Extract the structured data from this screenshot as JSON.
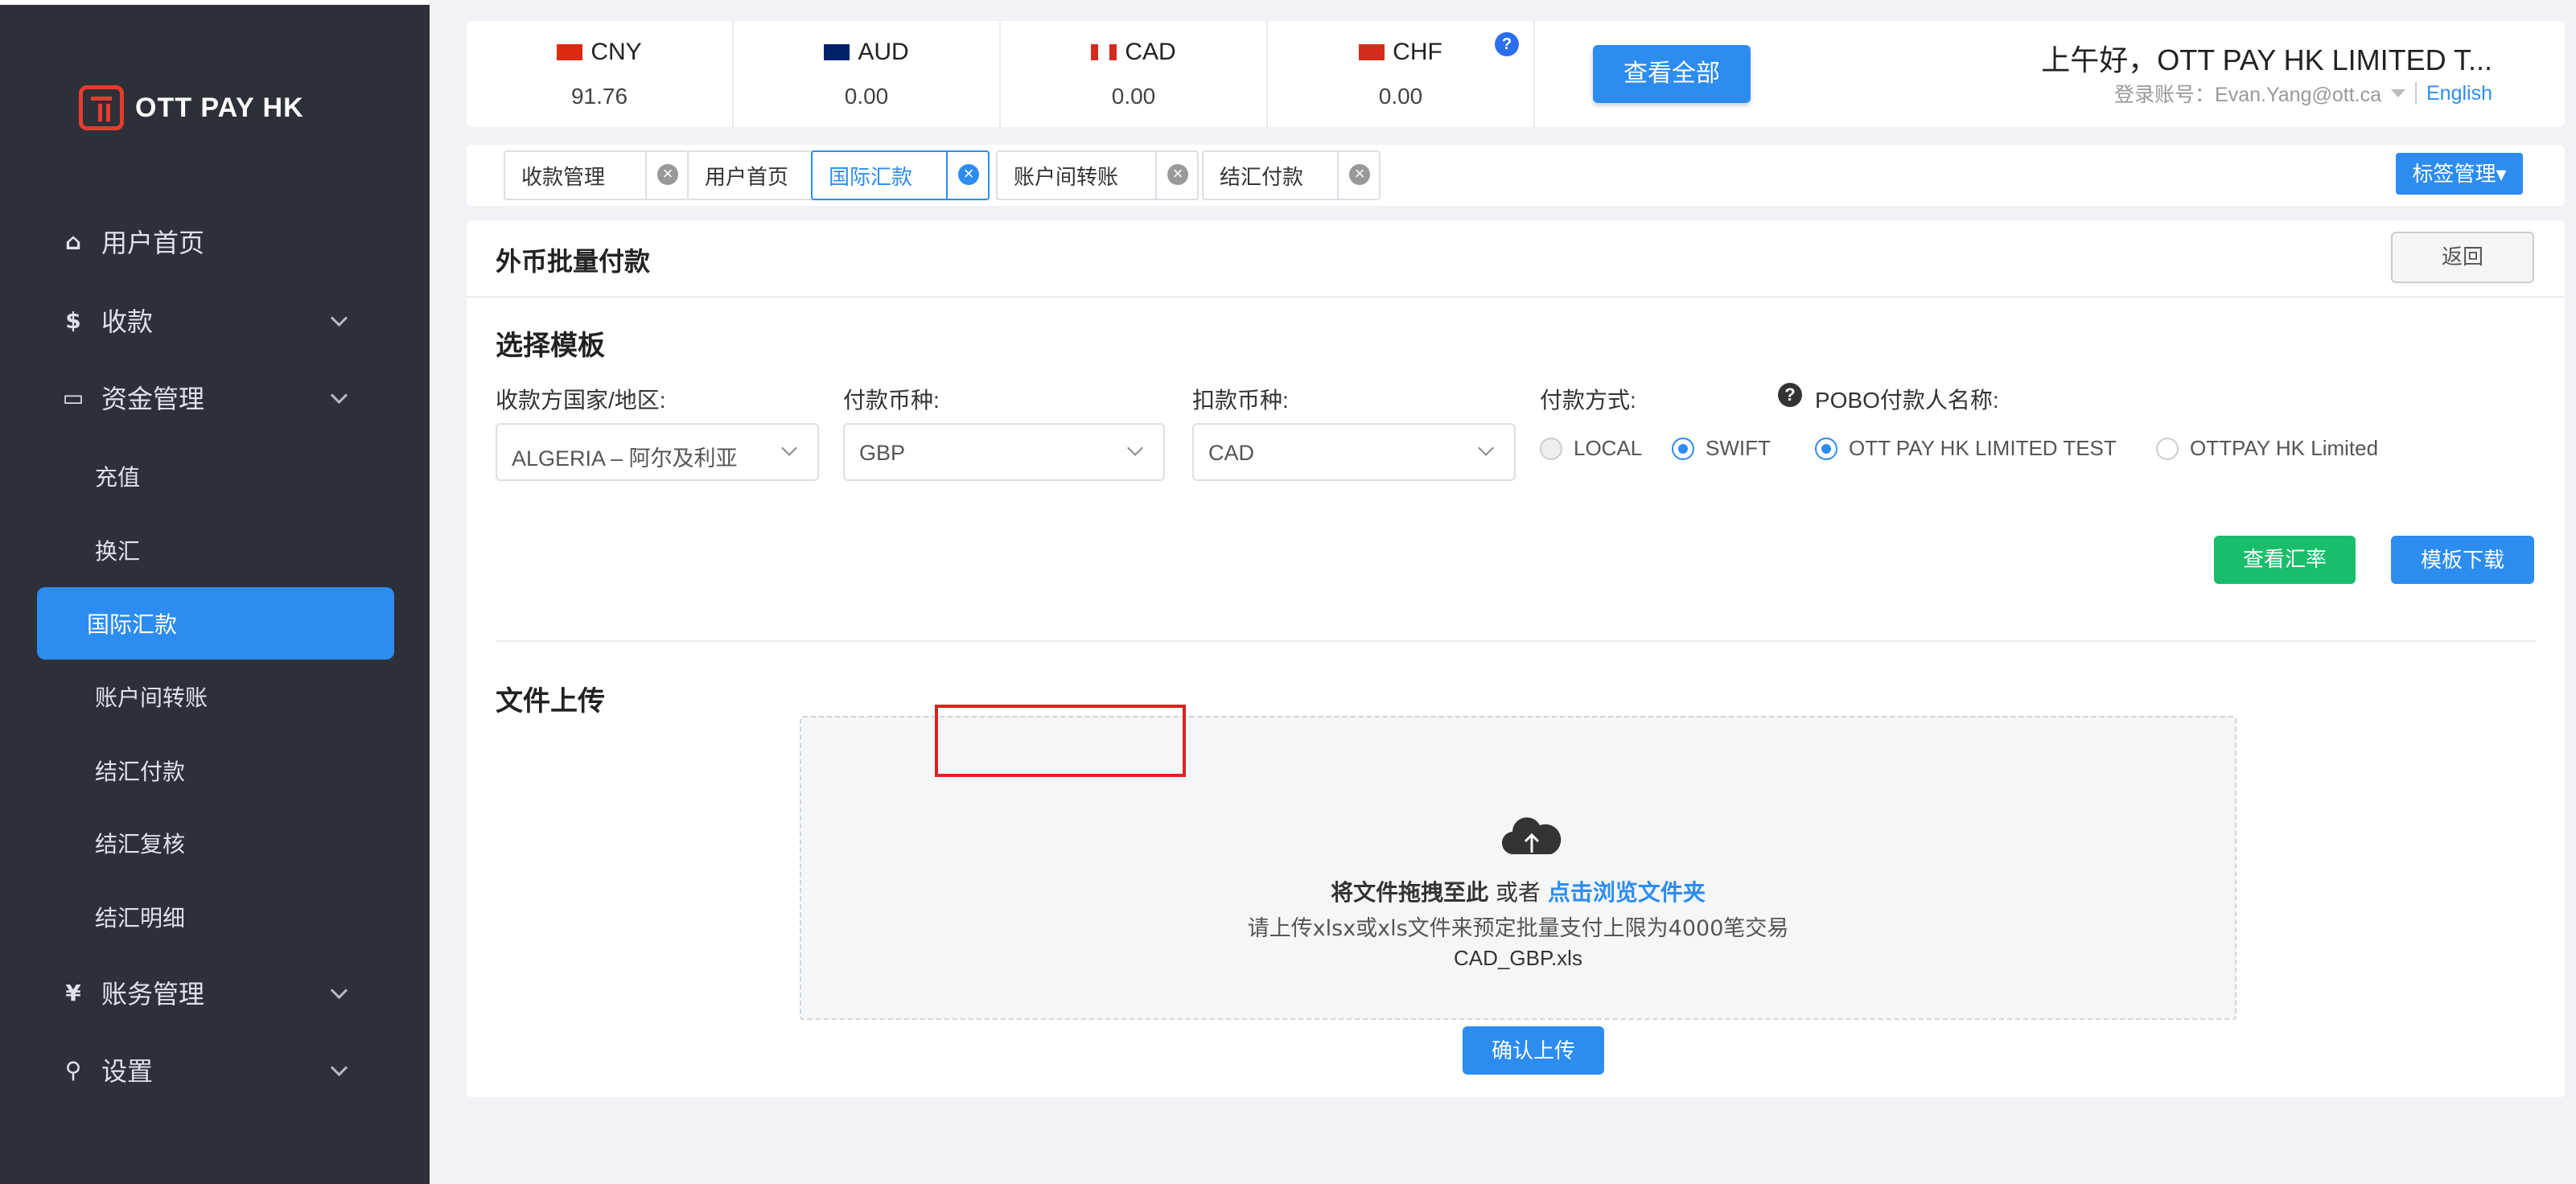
{
  "brand": {
    "name": "OTT PAY HK"
  },
  "sidebar": {
    "items": [
      {
        "label": "用户首页",
        "icon": "home-icon",
        "glyph": "⌂"
      },
      {
        "label": "收款",
        "icon": "dollar-icon",
        "glyph": "$"
      },
      {
        "label": "资金管理",
        "icon": "card-icon",
        "glyph": "▭"
      },
      {
        "label": "账务管理",
        "icon": "yen-icon",
        "glyph": "¥"
      },
      {
        "label": "设置",
        "icon": "search-icon",
        "glyph": "⚲"
      }
    ],
    "sub_items": [
      "充值",
      "换汇",
      "国际汇款",
      "账户间转账",
      "结汇付款",
      "结汇复核",
      "结汇明细"
    ],
    "active_sub": "国际汇款"
  },
  "balances": [
    {
      "code": "CNY",
      "value": "91.76"
    },
    {
      "code": "AUD",
      "value": "0.00"
    },
    {
      "code": "CAD",
      "value": "0.00"
    },
    {
      "code": "CHF",
      "value": "0.00"
    }
  ],
  "header": {
    "help_glyph": "?",
    "view_all": "查看全部",
    "greeting": "上午好，OTT PAY HK LIMITED T...",
    "account_label": "登录账号：Evan.Yang@ott.ca",
    "language": "English"
  },
  "tabs": [
    {
      "label": "收款管理",
      "closable": true
    },
    {
      "label": "用户首页",
      "closable": false
    },
    {
      "label": "国际汇款",
      "closable": true,
      "active": true
    },
    {
      "label": "账户间转账",
      "closable": true
    },
    {
      "label": "结汇付款",
      "closable": true
    }
  ],
  "tag_manage": "标签管理▾",
  "page": {
    "title": "外币批量付款",
    "back": "返回",
    "template_section": "选择模板",
    "labels": {
      "country": "收款方国家/地区:",
      "pay_currency": "付款币种:",
      "debit_currency": "扣款币种:",
      "pay_method": "付款方式:",
      "pobo": "POBO付款人名称:"
    },
    "values": {
      "country": "ALGERIA – 阿尔及利亚",
      "pay_currency": "GBP",
      "debit_currency": "CAD"
    },
    "pay_methods": [
      {
        "label": "LOCAL",
        "state": "disabled"
      },
      {
        "label": "SWIFT",
        "state": "selected"
      }
    ],
    "pobo_options": [
      {
        "label": "OTT PAY HK LIMITED TEST",
        "state": "selected"
      },
      {
        "label": "OTTPAY HK Limited",
        "state": "unselected"
      }
    ],
    "q_glyph": "?",
    "view_rate": "查看汇率",
    "template_download": "模板下载",
    "upload_section": "文件上传",
    "dropzone": {
      "drag_text": "将文件拖拽至此",
      "or_text": "或者",
      "browse_text": "点击浏览文件夹",
      "hint": "请上传xlsx或xls文件来预定批量支付上限为4000笔交易",
      "file_name": "CAD_GBP.xls"
    },
    "confirm_upload": "确认上传"
  },
  "colors": {
    "primary": "#2d8cf0",
    "success": "#19be6b",
    "sidebar": "#2d3038",
    "brand_red": "#e63c2e",
    "highlight": "#e02020"
  }
}
